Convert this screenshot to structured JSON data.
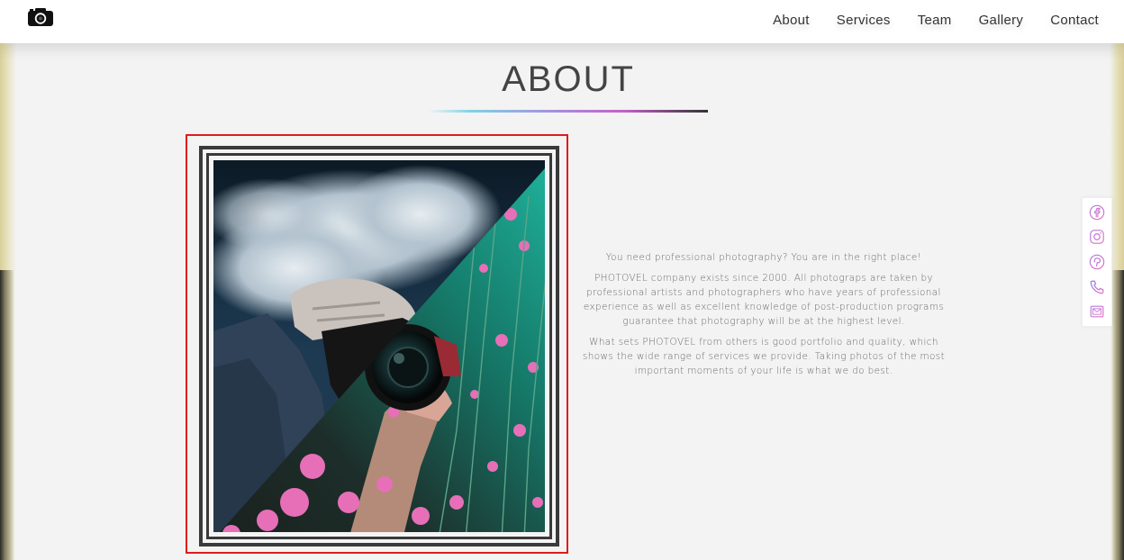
{
  "nav": {
    "logo_icon": "camera-icon",
    "links": [
      "About",
      "Services",
      "Team",
      "Gallery",
      "Contact"
    ]
  },
  "about": {
    "title": "ABOUT",
    "paragraphs": [
      "You need professional photography? You are in the right place!",
      "PHOTOVEL company exists since 2000. All photograps are taken by professional artists and photographers who have years of professional experience as well as excellent knowledge of post-production programs guarantee that photography will be at the highest level.",
      "What sets PHOTOVEL from others is good portfolio and quality, which shows the wide range of services we provide. Taking photos of the most important moments of your life is what we do best."
    ]
  },
  "social": {
    "icons": [
      "facebook-icon",
      "instagram-icon",
      "pinterest-icon",
      "phone-icon",
      "email-icon"
    ]
  },
  "colors": {
    "highlight": "#e01b1b",
    "accent_gradient": [
      "#7fd3e6",
      "#a68fe0",
      "#c460c8",
      "#333333"
    ]
  }
}
